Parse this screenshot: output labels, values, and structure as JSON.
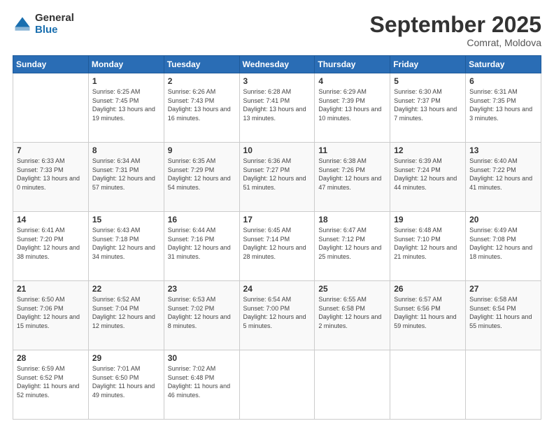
{
  "logo": {
    "general": "General",
    "blue": "Blue"
  },
  "header": {
    "month": "September 2025",
    "location": "Comrat, Moldova"
  },
  "weekdays": [
    "Sunday",
    "Monday",
    "Tuesday",
    "Wednesday",
    "Thursday",
    "Friday",
    "Saturday"
  ],
  "weeks": [
    [
      {
        "day": "",
        "sunrise": "",
        "sunset": "",
        "daylight": ""
      },
      {
        "day": "1",
        "sunrise": "Sunrise: 6:25 AM",
        "sunset": "Sunset: 7:45 PM",
        "daylight": "Daylight: 13 hours and 19 minutes."
      },
      {
        "day": "2",
        "sunrise": "Sunrise: 6:26 AM",
        "sunset": "Sunset: 7:43 PM",
        "daylight": "Daylight: 13 hours and 16 minutes."
      },
      {
        "day": "3",
        "sunrise": "Sunrise: 6:28 AM",
        "sunset": "Sunset: 7:41 PM",
        "daylight": "Daylight: 13 hours and 13 minutes."
      },
      {
        "day": "4",
        "sunrise": "Sunrise: 6:29 AM",
        "sunset": "Sunset: 7:39 PM",
        "daylight": "Daylight: 13 hours and 10 minutes."
      },
      {
        "day": "5",
        "sunrise": "Sunrise: 6:30 AM",
        "sunset": "Sunset: 7:37 PM",
        "daylight": "Daylight: 13 hours and 7 minutes."
      },
      {
        "day": "6",
        "sunrise": "Sunrise: 6:31 AM",
        "sunset": "Sunset: 7:35 PM",
        "daylight": "Daylight: 13 hours and 3 minutes."
      }
    ],
    [
      {
        "day": "7",
        "sunrise": "Sunrise: 6:33 AM",
        "sunset": "Sunset: 7:33 PM",
        "daylight": "Daylight: 13 hours and 0 minutes."
      },
      {
        "day": "8",
        "sunrise": "Sunrise: 6:34 AM",
        "sunset": "Sunset: 7:31 PM",
        "daylight": "Daylight: 12 hours and 57 minutes."
      },
      {
        "day": "9",
        "sunrise": "Sunrise: 6:35 AM",
        "sunset": "Sunset: 7:29 PM",
        "daylight": "Daylight: 12 hours and 54 minutes."
      },
      {
        "day": "10",
        "sunrise": "Sunrise: 6:36 AM",
        "sunset": "Sunset: 7:27 PM",
        "daylight": "Daylight: 12 hours and 51 minutes."
      },
      {
        "day": "11",
        "sunrise": "Sunrise: 6:38 AM",
        "sunset": "Sunset: 7:26 PM",
        "daylight": "Daylight: 12 hours and 47 minutes."
      },
      {
        "day": "12",
        "sunrise": "Sunrise: 6:39 AM",
        "sunset": "Sunset: 7:24 PM",
        "daylight": "Daylight: 12 hours and 44 minutes."
      },
      {
        "day": "13",
        "sunrise": "Sunrise: 6:40 AM",
        "sunset": "Sunset: 7:22 PM",
        "daylight": "Daylight: 12 hours and 41 minutes."
      }
    ],
    [
      {
        "day": "14",
        "sunrise": "Sunrise: 6:41 AM",
        "sunset": "Sunset: 7:20 PM",
        "daylight": "Daylight: 12 hours and 38 minutes."
      },
      {
        "day": "15",
        "sunrise": "Sunrise: 6:43 AM",
        "sunset": "Sunset: 7:18 PM",
        "daylight": "Daylight: 12 hours and 34 minutes."
      },
      {
        "day": "16",
        "sunrise": "Sunrise: 6:44 AM",
        "sunset": "Sunset: 7:16 PM",
        "daylight": "Daylight: 12 hours and 31 minutes."
      },
      {
        "day": "17",
        "sunrise": "Sunrise: 6:45 AM",
        "sunset": "Sunset: 7:14 PM",
        "daylight": "Daylight: 12 hours and 28 minutes."
      },
      {
        "day": "18",
        "sunrise": "Sunrise: 6:47 AM",
        "sunset": "Sunset: 7:12 PM",
        "daylight": "Daylight: 12 hours and 25 minutes."
      },
      {
        "day": "19",
        "sunrise": "Sunrise: 6:48 AM",
        "sunset": "Sunset: 7:10 PM",
        "daylight": "Daylight: 12 hours and 21 minutes."
      },
      {
        "day": "20",
        "sunrise": "Sunrise: 6:49 AM",
        "sunset": "Sunset: 7:08 PM",
        "daylight": "Daylight: 12 hours and 18 minutes."
      }
    ],
    [
      {
        "day": "21",
        "sunrise": "Sunrise: 6:50 AM",
        "sunset": "Sunset: 7:06 PM",
        "daylight": "Daylight: 12 hours and 15 minutes."
      },
      {
        "day": "22",
        "sunrise": "Sunrise: 6:52 AM",
        "sunset": "Sunset: 7:04 PM",
        "daylight": "Daylight: 12 hours and 12 minutes."
      },
      {
        "day": "23",
        "sunrise": "Sunrise: 6:53 AM",
        "sunset": "Sunset: 7:02 PM",
        "daylight": "Daylight: 12 hours and 8 minutes."
      },
      {
        "day": "24",
        "sunrise": "Sunrise: 6:54 AM",
        "sunset": "Sunset: 7:00 PM",
        "daylight": "Daylight: 12 hours and 5 minutes."
      },
      {
        "day": "25",
        "sunrise": "Sunrise: 6:55 AM",
        "sunset": "Sunset: 6:58 PM",
        "daylight": "Daylight: 12 hours and 2 minutes."
      },
      {
        "day": "26",
        "sunrise": "Sunrise: 6:57 AM",
        "sunset": "Sunset: 6:56 PM",
        "daylight": "Daylight: 11 hours and 59 minutes."
      },
      {
        "day": "27",
        "sunrise": "Sunrise: 6:58 AM",
        "sunset": "Sunset: 6:54 PM",
        "daylight": "Daylight: 11 hours and 55 minutes."
      }
    ],
    [
      {
        "day": "28",
        "sunrise": "Sunrise: 6:59 AM",
        "sunset": "Sunset: 6:52 PM",
        "daylight": "Daylight: 11 hours and 52 minutes."
      },
      {
        "day": "29",
        "sunrise": "Sunrise: 7:01 AM",
        "sunset": "Sunset: 6:50 PM",
        "daylight": "Daylight: 11 hours and 49 minutes."
      },
      {
        "day": "30",
        "sunrise": "Sunrise: 7:02 AM",
        "sunset": "Sunset: 6:48 PM",
        "daylight": "Daylight: 11 hours and 46 minutes."
      },
      {
        "day": "",
        "sunrise": "",
        "sunset": "",
        "daylight": ""
      },
      {
        "day": "",
        "sunrise": "",
        "sunset": "",
        "daylight": ""
      },
      {
        "day": "",
        "sunrise": "",
        "sunset": "",
        "daylight": ""
      },
      {
        "day": "",
        "sunrise": "",
        "sunset": "",
        "daylight": ""
      }
    ]
  ]
}
